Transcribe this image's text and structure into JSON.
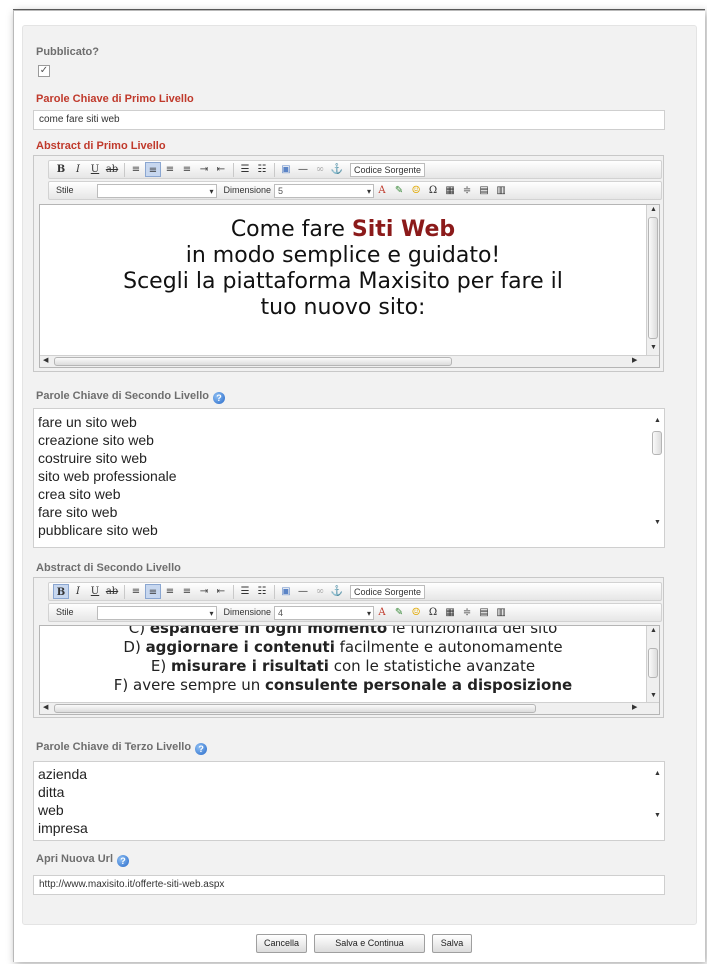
{
  "published": {
    "label": "Pubblicato?",
    "checked": true
  },
  "kw1": {
    "label": "Parole Chiave di Primo Livello",
    "value": "come fare siti web"
  },
  "abs1": {
    "label": "Abstract di Primo Livello",
    "line1_pre": "Come fare ",
    "line1_strong": "Siti Web",
    "line2": "in modo semplice e guidato!",
    "line3": "Scegli la piattaforma Maxisito per fare il",
    "line4": "tuo nuovo sito:",
    "accent_color": "#8b1a1a"
  },
  "toolbar": {
    "bold": "B",
    "italic": "I",
    "underline": "U",
    "source_label": "Codice Sorgente",
    "style_label": "Stile",
    "size_label": "Dimensione",
    "size_value_1": "5",
    "size_value_2": "4"
  },
  "kw2": {
    "label": "Parole Chiave di Secondo Livello",
    "lines": [
      "fare un sito web",
      "creazione sito web",
      "costruire sito web",
      "sito web professionale",
      "crea sito web",
      "fare sito web",
      "pubblicare sito web"
    ]
  },
  "abs2": {
    "label": "Abstract di Secondo Livello",
    "c_letter": "C) ",
    "c_bold": "espandere in ogni momento",
    "c_rest": " le funzionalità del sito",
    "d_letter": "D) ",
    "d_bold": "aggiornare i contenuti",
    "d_rest": " facilmente e autonomamente",
    "e_letter": "E) ",
    "e_bold": "misurare i risultati",
    "e_rest": " con le statistiche avanzate",
    "f_letter": "F) ",
    "f_rest": "avere sempre un ",
    "f_bold": "consulente personale a disposizione"
  },
  "kw3": {
    "label": "Parole Chiave di Terzo Livello",
    "lines": [
      "azienda",
      "ditta",
      "web",
      "impresa"
    ]
  },
  "url": {
    "label": "Apri Nuova Url",
    "value": "http://www.maxisito.it/offerte-siti-web.aspx"
  },
  "buttons": {
    "cancel": "Cancella",
    "save_continue": "Salva e Continua",
    "save": "Salva"
  },
  "help_icon_glyph": "?"
}
